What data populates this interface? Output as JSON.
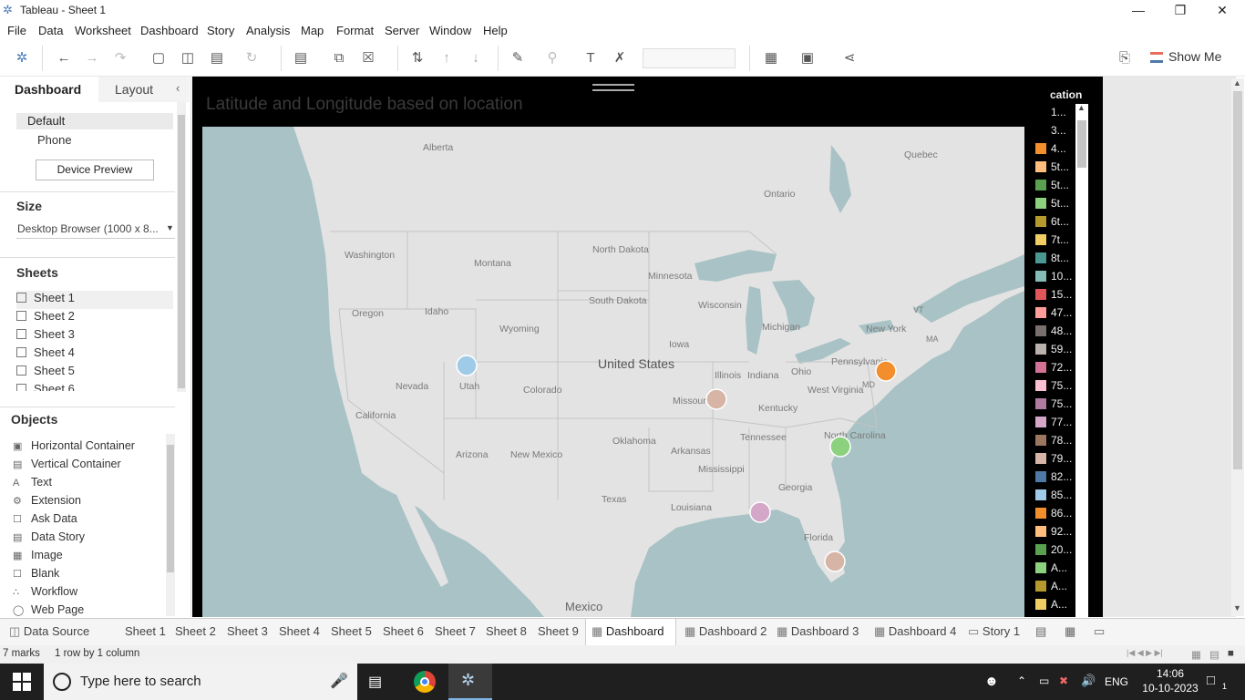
{
  "window": {
    "title": "Tableau - Sheet 1"
  },
  "menu": [
    "File",
    "Data",
    "Worksheet",
    "Dashboard",
    "Story",
    "Analysis",
    "Map",
    "Format",
    "Server",
    "Window",
    "Help"
  ],
  "toolbar": {
    "show_me": "Show Me"
  },
  "left_pane": {
    "tab_dashboard": "Dashboard",
    "tab_layout": "Layout",
    "device_default": "Default",
    "device_phone": "Phone",
    "device_preview": "Device Preview",
    "size_title": "Size",
    "size_value": "Desktop Browser (1000 x 8...",
    "sheets_title": "Sheets",
    "sheets": [
      "Sheet 1",
      "Sheet 2",
      "Sheet 3",
      "Sheet 4",
      "Sheet 5",
      "Sheet 6"
    ],
    "objects_title": "Objects",
    "objects": [
      "Horizontal Container",
      "Vertical Container",
      "Text",
      "Extension",
      "Ask Data",
      "Data Story",
      "Image",
      "Blank",
      "Workflow",
      "Web Page"
    ]
  },
  "dashboard": {
    "title": "Latitude and Longitude based on location",
    "legend_title": "cation",
    "legend": [
      {
        "label": "1...",
        "color": "#000000"
      },
      {
        "label": "3...",
        "color": "#000000"
      },
      {
        "label": "4...",
        "color": "#f28e2b"
      },
      {
        "label": "5t...",
        "color": "#ffbe7d"
      },
      {
        "label": "5t...",
        "color": "#59a14f"
      },
      {
        "label": "5t...",
        "color": "#8cd17d"
      },
      {
        "label": "6t...",
        "color": "#b6992d"
      },
      {
        "label": "7t...",
        "color": "#f1ce63"
      },
      {
        "label": "8t...",
        "color": "#499894"
      },
      {
        "label": "10...",
        "color": "#86bcb6"
      },
      {
        "label": "15...",
        "color": "#e15759"
      },
      {
        "label": "47...",
        "color": "#ff9d9a"
      },
      {
        "label": "48...",
        "color": "#79706e"
      },
      {
        "label": "59...",
        "color": "#bab0ac"
      },
      {
        "label": "72...",
        "color": "#d37295"
      },
      {
        "label": "75...",
        "color": "#fabfd2"
      },
      {
        "label": "75...",
        "color": "#b07aa1"
      },
      {
        "label": "77...",
        "color": "#d4a6c8"
      },
      {
        "label": "78...",
        "color": "#9d7660"
      },
      {
        "label": "79...",
        "color": "#d7b5a6"
      },
      {
        "label": "82...",
        "color": "#4e79a7"
      },
      {
        "label": "85...",
        "color": "#a0cbe8"
      },
      {
        "label": "86...",
        "color": "#f28e2b"
      },
      {
        "label": "92...",
        "color": "#ffbe7d"
      },
      {
        "label": "20...",
        "color": "#59a14f"
      },
      {
        "label": "A...",
        "color": "#8cd17d"
      },
      {
        "label": "A...",
        "color": "#b6992d"
      },
      {
        "label": "A...",
        "color": "#f1ce63"
      }
    ],
    "map_labels": [
      "Alberta",
      "Ontario",
      "Quebec",
      "Washington",
      "Montana",
      "North Dakota",
      "Minnesota",
      "Oregon",
      "Idaho",
      "South Dakota",
      "Wisconsin",
      "Michigan",
      "New York",
      "Wyoming",
      "United States",
      "Iowa",
      "Pennsylvania",
      "Nevada",
      "Utah",
      "Colorado",
      "Illinois",
      "Indiana",
      "Ohio",
      "Missouri",
      "West Virginia",
      "California",
      "Kentucky",
      "North Carolina",
      "Oklahoma",
      "Tennessee",
      "Arizona",
      "New Mexico",
      "Arkansas",
      "Mississippi",
      "Georgia",
      "Texas",
      "Louisiana",
      "Florida",
      "Mexico",
      "MD",
      "MA",
      "VT"
    ],
    "marks": [
      {
        "name": "utah",
        "color": "#a0cbe8"
      },
      {
        "name": "missouri",
        "color": "#d7b5a6"
      },
      {
        "name": "maryland",
        "color": "#f28e2b"
      },
      {
        "name": "north-carolina",
        "color": "#8cd17d"
      },
      {
        "name": "louisiana",
        "color": "#d4a6c8"
      },
      {
        "name": "florida",
        "color": "#d7b5a6"
      }
    ]
  },
  "sheet_tabs": [
    "Data Source",
    "Sheet 1",
    "Sheet 2",
    "Sheet 3",
    "Sheet 4",
    "Sheet 5",
    "Sheet 6",
    "Sheet 7",
    "Sheet 8",
    "Sheet 9",
    "Dashboard 1",
    "Dashboard 2",
    "Dashboard 3",
    "Dashboard 4",
    "Story 1"
  ],
  "status": {
    "marks": "7 marks",
    "rows": "1 row by 1 column"
  },
  "taskbar": {
    "search_placeholder": "Type here to search",
    "lang": "ENG",
    "time": "14:06",
    "date": "10-10-2023",
    "notif": "1"
  }
}
